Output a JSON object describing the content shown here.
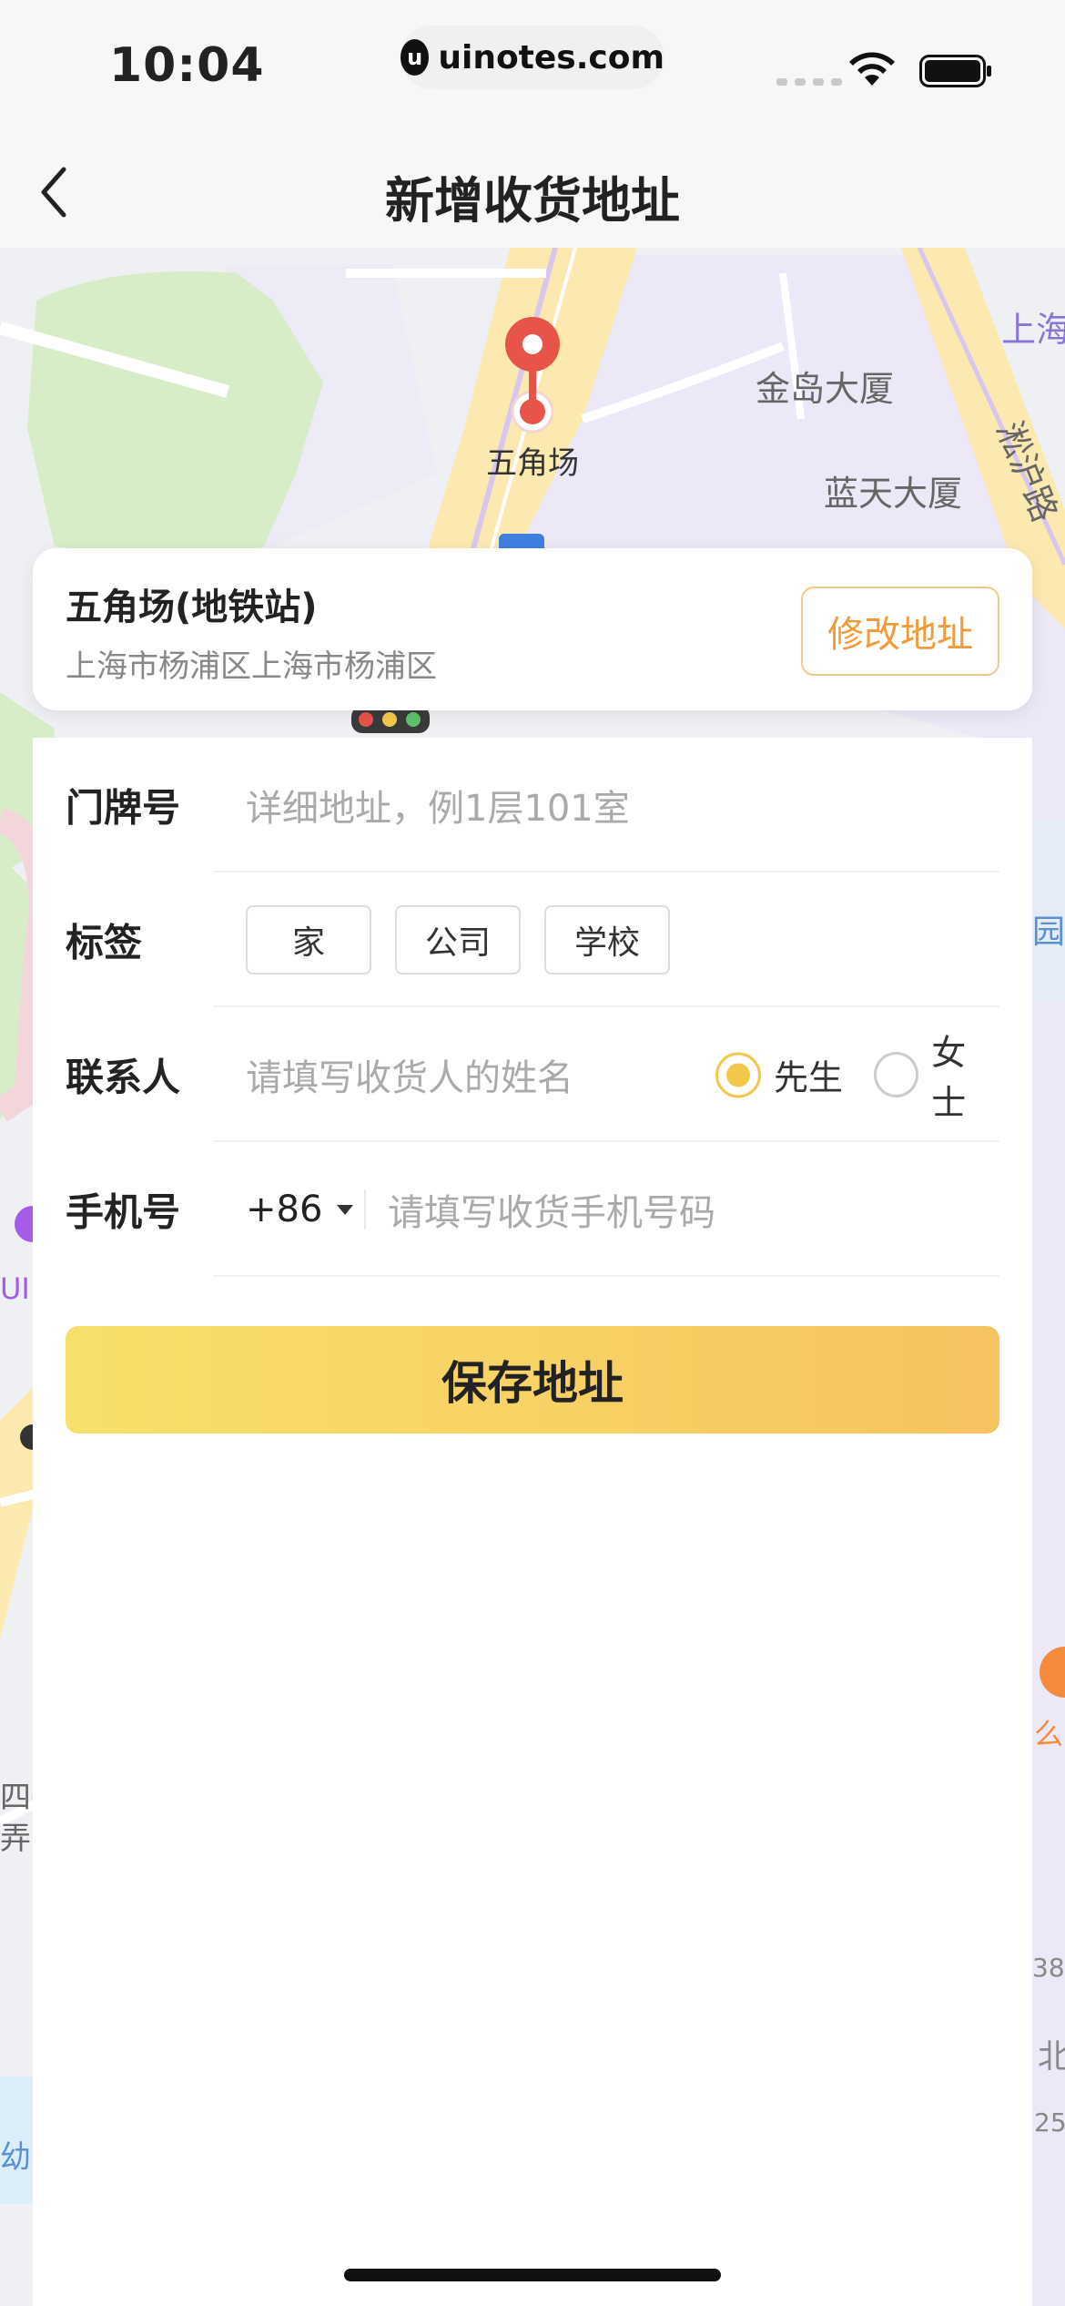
{
  "status_bar": {
    "time": "10:04",
    "url": "uinotes.com",
    "url_icon": "u"
  },
  "nav": {
    "title": "新增收货地址",
    "back_icon": "chevron-left-icon"
  },
  "map": {
    "pin_label": "五角场",
    "labels": [
      "金岛大厦",
      "蓝天大厦",
      "淞沪路",
      "上海",
      "园",
      "UI",
      "四平",
      "弄",
      "38",
      "北",
      "25",
      "幼",
      "么"
    ],
    "colors": {
      "road": "#fce9b0",
      "block": "#ece8f7",
      "green": "#d6edc8",
      "water": "#dbeefa",
      "pin": "#e8534a"
    }
  },
  "address_card": {
    "name": "五角场(地铁站)",
    "detail": "上海市杨浦区上海市杨浦区",
    "edit_label": "修改地址"
  },
  "form": {
    "door": {
      "label": "门牌号",
      "placeholder": "详细地址，例1层101室"
    },
    "tags": {
      "label": "标签",
      "options": [
        "家",
        "公司",
        "学校"
      ]
    },
    "contact": {
      "label": "联系人",
      "placeholder": "请填写收货人的姓名",
      "genders": [
        {
          "label": "先生",
          "selected": true
        },
        {
          "label": "女士",
          "selected": false
        }
      ]
    },
    "phone": {
      "label": "手机号",
      "country_code": "+86",
      "placeholder": "请填写收货手机号码"
    },
    "save_label": "保存地址"
  },
  "accent_color": "#f2c84b",
  "edit_color": "#f29b38"
}
